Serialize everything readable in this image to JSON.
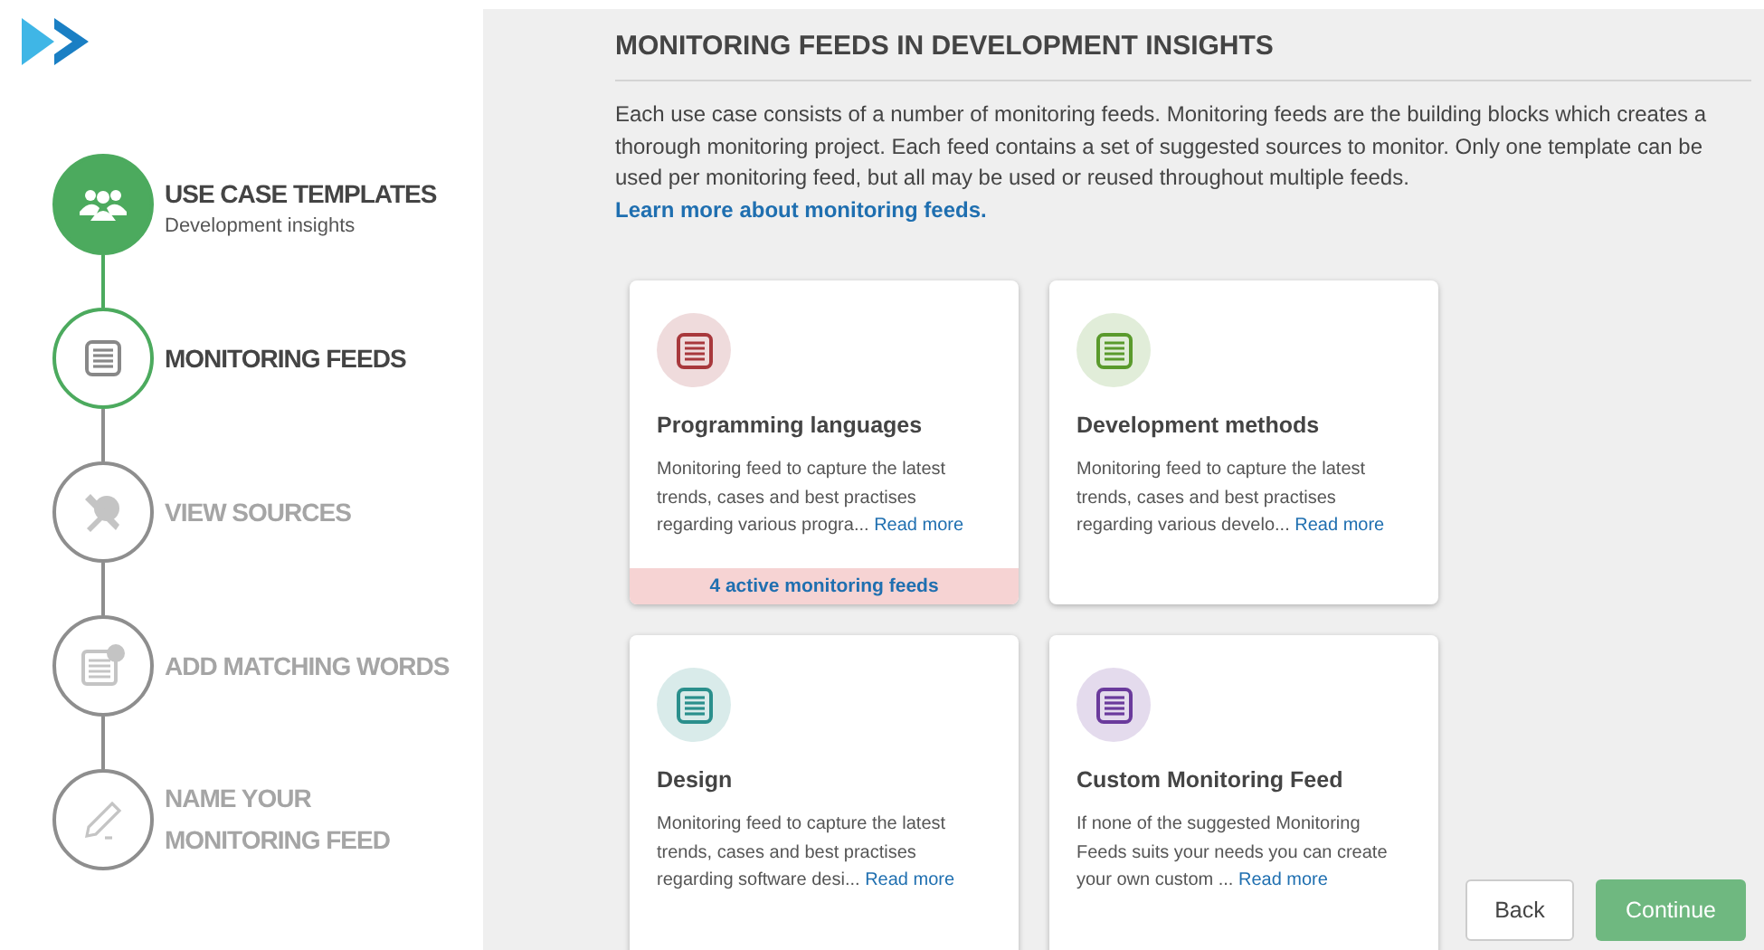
{
  "steps": [
    {
      "title": "USE CASE TEMPLATES",
      "subtitle": "Development insights",
      "completed": true,
      "selected": false
    },
    {
      "title": "MONITORING FEEDS",
      "completed": false,
      "selected": true
    },
    {
      "title": "VIEW SOURCES",
      "completed": false,
      "selected": false
    },
    {
      "title": "ADD MATCHING WORDS",
      "completed": false,
      "selected": false
    },
    {
      "title": "NAME YOUR MONITORING FEED",
      "completed": false,
      "selected": false
    }
  ],
  "heading": "MONITORING FEEDS IN DEVELOPMENT INSIGHTS",
  "intro": "Each use case consists of a number of monitoring feeds. Monitoring feeds are the building blocks which creates a thorough monitoring project. Each feed contains a set of suggested sources to monitor. Only one template can be used per monitoring feed, but all may be used or reused throughout multiple feeds.",
  "intro_link": "Learn more about monitoring feeds.",
  "cards": [
    {
      "title": "Programming languages",
      "description": "Monitoring feed to capture the latest trends, cases and best practises regarding various progra...",
      "link": "Read more",
      "color": "#a8383c",
      "footer": "4 active monitoring feeds"
    },
    {
      "title": "Development methods",
      "description": "Monitoring feed to capture the latest trends, cases and best practises regarding various develo...",
      "link": "Read more",
      "color": "#5a9a2c"
    },
    {
      "title": "Design",
      "description": "Monitoring feed to capture the latest trends, cases and best practises regarding software desi...",
      "link": "Read more",
      "color": "#2a8f8c"
    },
    {
      "title": "Custom Monitoring Feed",
      "description": "If none of the suggested Monitoring Feeds suits your needs you can create your own custom ...",
      "link": "Read more",
      "color": "#6a3a9c"
    }
  ],
  "buttons": [
    {
      "label": "Back",
      "kind": "secondary"
    },
    {
      "label": "Continue",
      "kind": "primary"
    }
  ]
}
